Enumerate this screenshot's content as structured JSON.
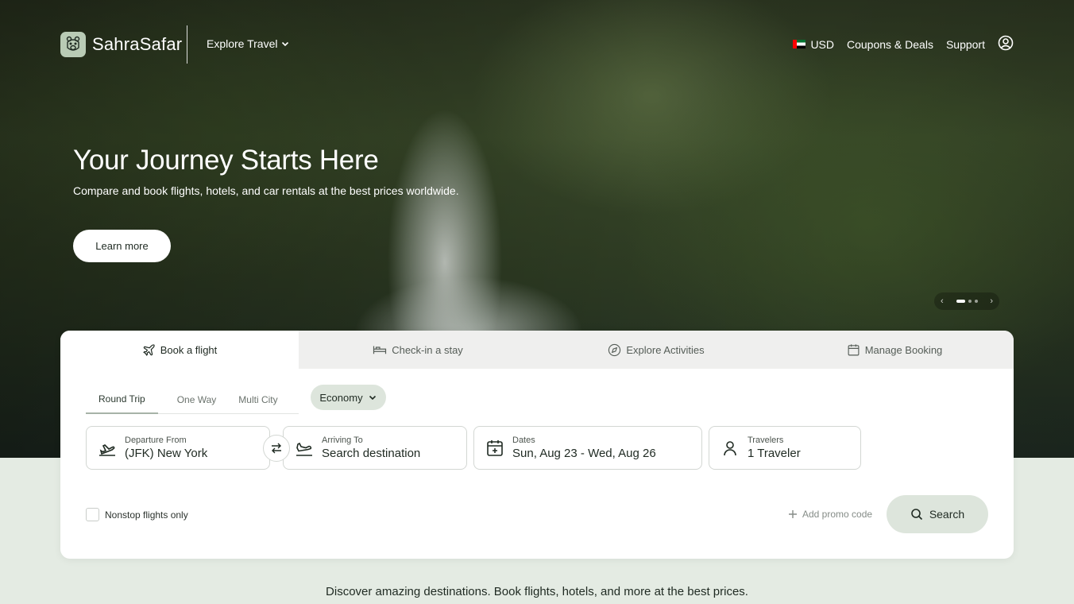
{
  "brand": {
    "name": "SahraSafar"
  },
  "nav": {
    "explore_label": "Explore Travel",
    "currency": "USD",
    "coupons_label": "Coupons & Deals",
    "support_label": "Support"
  },
  "hero": {
    "title": "Your Journey Starts Here",
    "subtitle": "Compare and book flights, hotels, and car rentals at the best prices worldwide.",
    "cta_label": "Learn more",
    "carousel": {
      "slide_count": 3,
      "active_index": 0
    }
  },
  "booking": {
    "tabs": [
      {
        "label": "Book a flight",
        "icon": "plane-icon",
        "active": true
      },
      {
        "label": "Check-in a stay",
        "icon": "bed-icon",
        "active": false
      },
      {
        "label": "Explore Activities",
        "icon": "compass-icon",
        "active": false
      },
      {
        "label": "Manage Booking",
        "icon": "calendar-icon",
        "active": false
      }
    ],
    "trip_types": [
      "Round Trip",
      "One Way",
      "Multi City"
    ],
    "active_trip_type": "Round Trip",
    "cabin_class": "Economy",
    "fields": {
      "departure": {
        "label": "Departure From",
        "value": "(JFK) New York"
      },
      "arrival": {
        "label": "Arriving To",
        "value": "Search destination"
      },
      "dates": {
        "label": "Dates",
        "value": "Sun, Aug 23 - Wed, Aug 26"
      },
      "travelers": {
        "label": "Travelers",
        "value": "1 Traveler"
      }
    },
    "nonstop_label": "Nonstop flights only",
    "nonstop_checked": false,
    "promo_label": "Add promo code",
    "search_label": "Search"
  },
  "tagline": "Discover amazing destinations. Book flights, hotels, and more at the best prices.",
  "colors": {
    "accent_soft": "#dde5dc",
    "page_bg": "#e4ebe3",
    "text": "#1f2a22"
  }
}
